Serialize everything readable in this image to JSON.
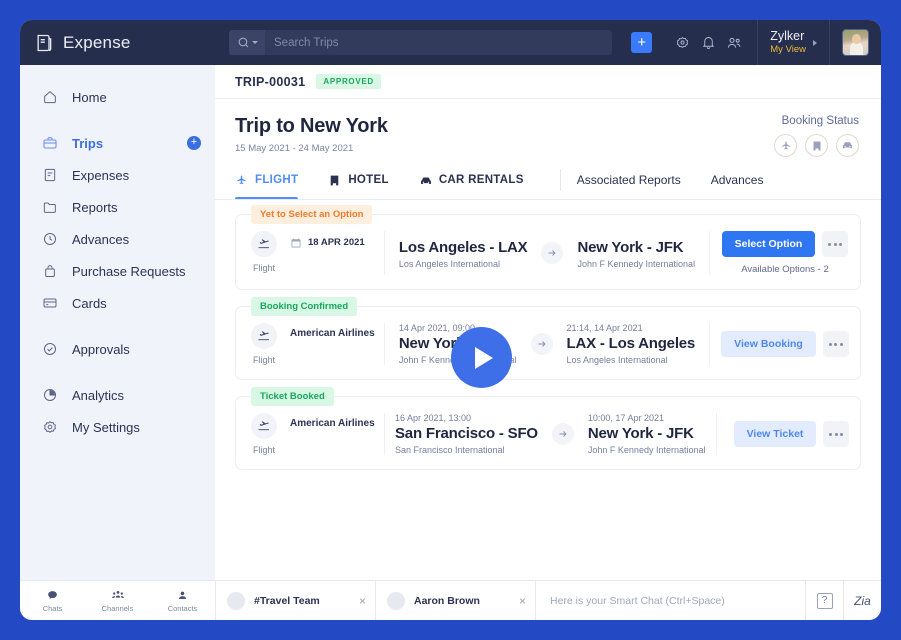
{
  "app": {
    "brand": "Expense",
    "brand_icon": "receipt-icon"
  },
  "topbar": {
    "search_placeholder": "Search Trips",
    "search_value": "",
    "search_icon": "search-icon",
    "add_label": "+",
    "icons": [
      {
        "name": "gear-icon"
      },
      {
        "name": "bell-icon"
      },
      {
        "name": "users-icon"
      }
    ],
    "user": {
      "name": "Zylker",
      "subtitle": "My View"
    }
  },
  "sidebar": {
    "items": [
      {
        "label": "Home",
        "icon": "home-icon",
        "active": false,
        "add": false
      },
      {
        "label": "Trips",
        "icon": "briefcase-icon",
        "active": true,
        "add": true
      },
      {
        "label": "Expenses",
        "icon": "receipt-icon",
        "active": false,
        "add": false
      },
      {
        "label": "Reports",
        "icon": "folder-icon",
        "active": false,
        "add": false
      },
      {
        "label": "Advances",
        "icon": "clock-icon",
        "active": false,
        "add": false
      },
      {
        "label": "Purchase Requests",
        "icon": "bag-icon",
        "active": false,
        "add": false
      },
      {
        "label": "Cards",
        "icon": "card-icon",
        "active": false,
        "add": false
      },
      {
        "label": "Approvals",
        "icon": "check-circle-icon",
        "active": false,
        "add": false
      },
      {
        "label": "Analytics",
        "icon": "pie-chart-icon",
        "active": false,
        "add": false
      },
      {
        "label": "My Settings",
        "icon": "gear-icon",
        "active": false,
        "add": false
      }
    ],
    "add_badge_label": "+"
  },
  "breadcrumb": {
    "trip_id": "TRIP-00031",
    "status": "APPROVED"
  },
  "trip": {
    "title": "Trip to New York",
    "dates": "15 May 2021 - 24 May 2021",
    "booking_status_label": "Booking Status",
    "booking_status_icons": [
      {
        "name": "plane-icon"
      },
      {
        "name": "hotel-icon"
      },
      {
        "name": "car-icon"
      }
    ]
  },
  "tabs": [
    {
      "label": "FLIGHT",
      "icon": "plane-icon",
      "active": true
    },
    {
      "label": "HOTEL",
      "icon": "hotel-icon",
      "active": false
    },
    {
      "label": "CAR RENTALS",
      "icon": "car-icon",
      "active": false
    }
  ],
  "tabs_plain": [
    {
      "label": "Associated Reports"
    },
    {
      "label": "Advances"
    }
  ],
  "cards": [
    {
      "tag": "Yet to Select an Option",
      "tag_type": "pending",
      "type_label": "Flight",
      "type_icon": "plane-takeoff-icon",
      "date": "18 APR 2021",
      "airline": "",
      "from": {
        "time": "",
        "city": "Los Angeles - LAX",
        "airport": "Los Angeles International"
      },
      "to": {
        "time": "",
        "city": "New York - JFK",
        "airport": "John F Kennedy International"
      },
      "action_label": "Select Option",
      "action_style": "primary",
      "note": "Available Options - 2"
    },
    {
      "tag": "Booking Confirmed",
      "tag_type": "confirmed",
      "type_label": "Flight",
      "type_icon": "plane-takeoff-icon",
      "date": "",
      "airline": "American Airlines",
      "from": {
        "time": "14 Apr 2021, 09:00",
        "city": "New York - JFK",
        "airport": "John F Kennedy International"
      },
      "to": {
        "time": "21:14, 14 Apr 2021",
        "city": "LAX - Los Angeles",
        "airport": "Los Angeles International"
      },
      "action_label": "View Booking",
      "action_style": "soft",
      "note": ""
    },
    {
      "tag": "Ticket Booked",
      "tag_type": "confirmed",
      "type_label": "Flight",
      "type_icon": "plane-takeoff-icon",
      "date": "",
      "airline": "American Airlines",
      "from": {
        "time": "16 Apr 2021, 13:00",
        "city": "San Francisco - SFO",
        "airport": "San Francisco International"
      },
      "to": {
        "time": "10:00, 17 Apr 2021",
        "city": "New York - JFK",
        "airport": "John F Kennedy International"
      },
      "action_label": "View Ticket",
      "action_style": "soft",
      "note": ""
    }
  ],
  "overlay": {
    "play_button": "play-icon"
  },
  "bottombar": {
    "tools": [
      {
        "label": "Chats",
        "icon": "chat-icon"
      },
      {
        "label": "Channels",
        "icon": "channels-icon"
      },
      {
        "label": "Contacts",
        "icon": "contact-icon"
      }
    ],
    "chips": [
      {
        "name": "#Travel Team",
        "close": "×"
      },
      {
        "name": "Aaron Brown",
        "close": "×"
      }
    ],
    "smart_chat_placeholder": "Here is your Smart Chat (Ctrl+Space)",
    "smart_chat_value": "",
    "help_label": "?",
    "zia_label": "Zia"
  },
  "colors": {
    "accent_blue": "#3a7afe",
    "topbar_navy": "#262e4e",
    "page_blue": "#2449c4",
    "green": "#17a85e",
    "orange": "#f07b2a"
  }
}
